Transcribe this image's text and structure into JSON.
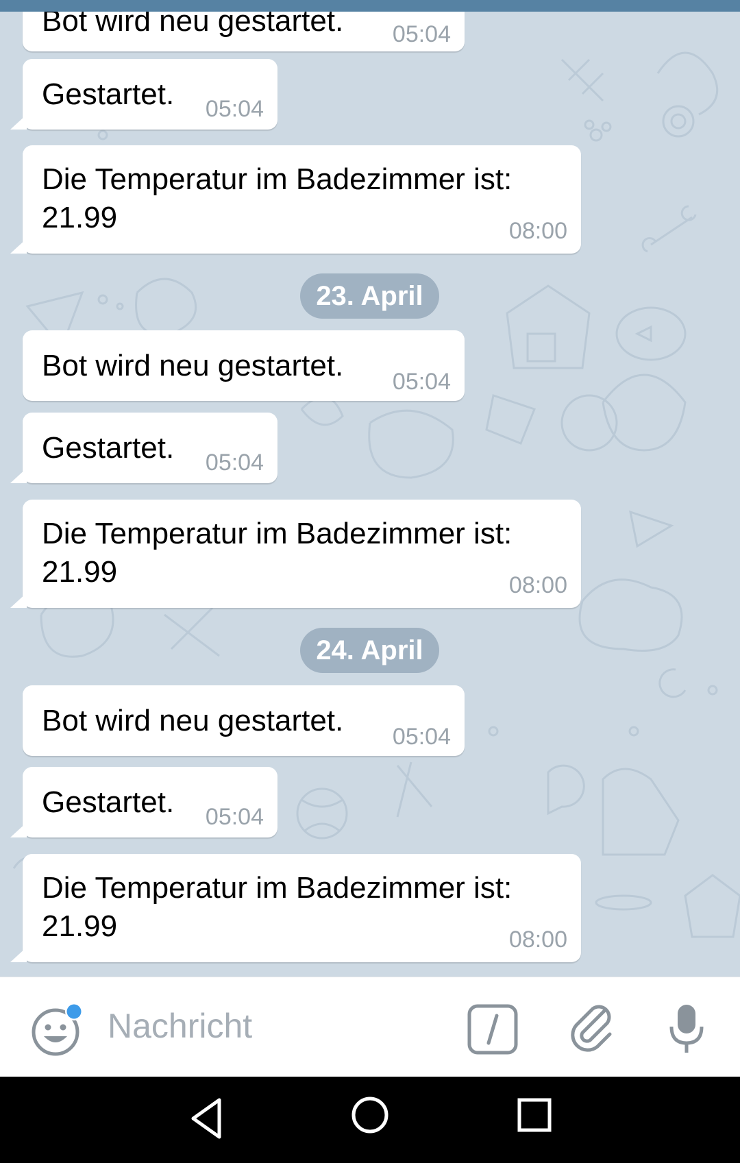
{
  "chat": {
    "messages": [
      {
        "text": "Bot wird neu gestartet.",
        "time": "05:04"
      },
      {
        "text": "Gestartet.",
        "time": "05:04"
      },
      {
        "text_line1": "Die Temperatur im Badezimmer ist:",
        "text_line2": "21.99",
        "time": "08:00"
      },
      {
        "date": "23. April"
      },
      {
        "text": "Bot wird neu gestartet.",
        "time": "05:04"
      },
      {
        "text": "Gestartet.",
        "time": "05:04"
      },
      {
        "text_line1": "Die Temperatur im Badezimmer ist:",
        "text_line2": "21.99",
        "time": "08:00"
      },
      {
        "date": "24. April"
      },
      {
        "text": "Bot wird neu gestartet.",
        "time": "05:04"
      },
      {
        "text": "Gestartet.",
        "time": "05:04"
      },
      {
        "text_line1": "Die Temperatur im Badezimmer ist:",
        "text_line2": "21.99",
        "time": "08:00"
      }
    ]
  },
  "composer": {
    "placeholder": "Nachricht",
    "icons": [
      "emoji-icon",
      "bot-command-icon",
      "attach-paperclip-icon",
      "microphone-icon"
    ],
    "emoji_badge_color": "#3d9be9"
  },
  "navbar": {
    "icons": [
      "back-triangle-icon",
      "home-circle-icon",
      "recents-square-icon"
    ]
  },
  "colors": {
    "header": "#5682a3",
    "chat_background": "#cdd9e3",
    "bubble": "#ffffff",
    "timestamp": "#9aa3ab",
    "date_pill": "#849aaf"
  }
}
